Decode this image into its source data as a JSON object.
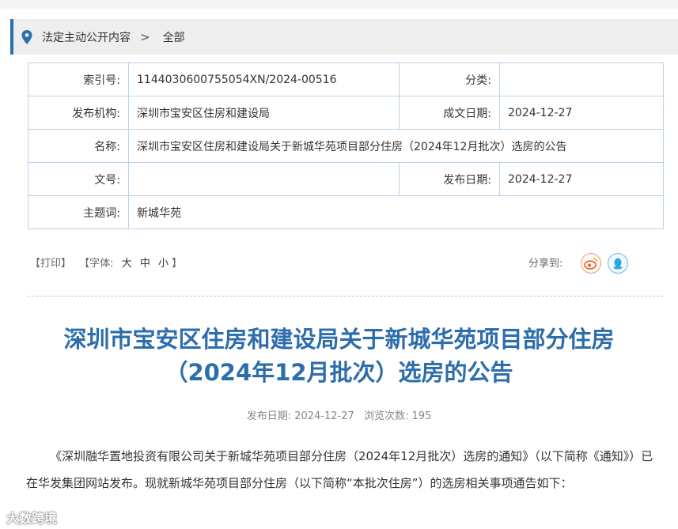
{
  "breadcrumb": {
    "section": "法定主动公开内容",
    "separator": ">",
    "current": "全部"
  },
  "meta": {
    "index_label": "索引号:",
    "index_value": "1144030600755054XN/2024-00516",
    "category_label": "分类:",
    "category_value": "",
    "publisher_label": "发布机构:",
    "publisher_value": "深圳市宝安区住房和建设局",
    "created_label": "成文日期:",
    "created_value": "2024-12-27",
    "name_label": "名称:",
    "name_value": "深圳市宝安区住房和建设局关于新城华苑项目部分住房（2024年12月批次）选房的公告",
    "docno_label": "文号:",
    "docno_value": "",
    "published_label": "发布日期:",
    "published_value": "2024-12-27",
    "subject_label": "主题词:",
    "subject_value": "新城华苑"
  },
  "toolbar": {
    "print": "【打印】",
    "font_open": "【字体:",
    "font_large": "大",
    "font_medium": "中",
    "font_small": "小",
    "font_close": "】",
    "share_label": "分享到:"
  },
  "article": {
    "title_line1": "深圳市宝安区住房和建设局关于新城华苑项目部分住房",
    "title_line2": "（2024年12月批次）选房的公告",
    "pub_date_label": "发布日期:",
    "pub_date": "2024-12-27",
    "views_label": "浏览次数:",
    "views": "195",
    "body": "《深圳融华置地投资有限公司关于新城华苑项目部分住房（2024年12月批次）选房的通知》（以下简称《通知》）已在华发集团网站发布。现就新城华苑项目部分住房（以下简称“本批次住房”）的选房相关事项通告如下："
  },
  "watermark": "大数跨境",
  "colors": {
    "accent": "#2a6fb0",
    "title": "#2c6dab",
    "table_border": "#b9d3ea",
    "weibo": "#e6622e",
    "qq": "#2ea7e0"
  }
}
